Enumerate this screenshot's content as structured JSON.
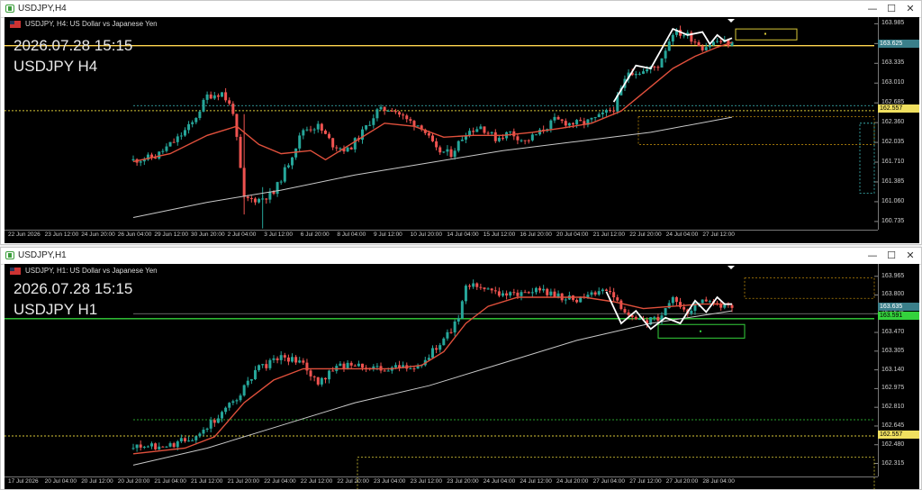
{
  "colors": {
    "bull": "#26a69a",
    "bear": "#ef5350",
    "ma_fast": "#e0503c",
    "ma_slow": "#c8c8c8",
    "hline": "#ffd54f",
    "gline": "#34d23c",
    "dots": "#d8c838",
    "zig": "#ffffff",
    "cyan": "#3fc0c0",
    "orange": "#b8860b"
  },
  "windows": [
    {
      "title": "USDJPY,H4",
      "description": "USDJPY, H4:  US Dollar vs Japanese Yen",
      "overlay_datetime": "2026.07.28 15:15",
      "overlay_symbol": "USDJPY H4",
      "price_labels": [
        "163.985",
        "163.660",
        "163.335",
        "163.010",
        "162.685",
        "162.360",
        "162.035",
        "161.710",
        "161.385",
        "161.060",
        "160.735"
      ],
      "current_price": "163.625",
      "dotted_price": "162.557",
      "time_labels": [
        "22 Jun 2026",
        "23 Jun 12:00",
        "24 Jun 20:00",
        "26 Jun 04:00",
        "29 Jun 12:00",
        "30 Jun 20:00",
        "2 Jul 04:00",
        "3 Jul 12:00",
        "6 Jul 20:00",
        "8 Jul 04:00",
        "9 Jul 12:00",
        "10 Jul 20:00",
        "14 Jul 04:00",
        "15 Jul 12:00",
        "16 Jul 20:00",
        "20 Jul 04:00",
        "21 Jul 12:00",
        "22 Jul 20:00",
        "24 Jul 04:00",
        "27 Jul 12:00"
      ],
      "buttons": {
        "minimize": "—",
        "maximize": "☐",
        "close": "✕"
      }
    },
    {
      "title": "USDJPY,H1",
      "description": "USDJPY, H1:  US Dollar vs Japanese Yen",
      "overlay_datetime": "2026.07.28 15:15",
      "overlay_symbol": "USDJPY H1",
      "price_labels": [
        "163.965",
        "163.800",
        "163.635",
        "163.470",
        "163.305",
        "163.140",
        "162.975",
        "162.810",
        "162.645",
        "162.480",
        "162.315"
      ],
      "current_price": "163.635",
      "green_price": "163.591",
      "dotted_price": "162.557",
      "time_labels": [
        "17 Jul 2026",
        "20 Jul 04:00",
        "20 Jul 12:00",
        "20 Jul 20:00",
        "21 Jul 04:00",
        "21 Jul 12:00",
        "21 Jul 20:00",
        "22 Jul 04:00",
        "22 Jul 12:00",
        "22 Jul 20:00",
        "23 Jul 04:00",
        "23 Jul 12:00",
        "23 Jul 20:00",
        "24 Jul 04:00",
        "24 Jul 12:00",
        "24 Jul 20:00",
        "27 Jul 04:00",
        "27 Jul 12:00",
        "27 Jul 20:00",
        "28 Jul 04:00"
      ],
      "buttons": {
        "minimize": "—",
        "maximize": "☐",
        "close": "✕"
      }
    }
  ],
  "chart_data": [
    {
      "type": "candlestick",
      "symbol": "USDJPY",
      "timeframe": "H4",
      "ylim": [
        160.6,
        164.05
      ],
      "close_path": [
        [
          0,
          161.74
        ],
        [
          6,
          161.8
        ],
        [
          12,
          162.1
        ],
        [
          16,
          162.35
        ],
        [
          20,
          162.8
        ],
        [
          24,
          162.85
        ],
        [
          27,
          162.55
        ],
        [
          30,
          161.1
        ],
        [
          34,
          161.1
        ],
        [
          38,
          161.2
        ],
        [
          42,
          161.7
        ],
        [
          46,
          162.25
        ],
        [
          50,
          162.3
        ],
        [
          54,
          162.0
        ],
        [
          58,
          161.9
        ],
        [
          62,
          162.2
        ],
        [
          66,
          162.55
        ],
        [
          70,
          162.6
        ],
        [
          74,
          162.4
        ],
        [
          78,
          162.3
        ],
        [
          82,
          161.9
        ],
        [
          86,
          161.85
        ],
        [
          90,
          162.2
        ],
        [
          94,
          162.3
        ],
        [
          98,
          162.1
        ],
        [
          102,
          162.2
        ],
        [
          106,
          162.05
        ],
        [
          110,
          162.2
        ],
        [
          114,
          162.4
        ],
        [
          118,
          162.35
        ],
        [
          122,
          162.35
        ],
        [
          126,
          162.45
        ],
        [
          130,
          162.6
        ],
        [
          134,
          163.2
        ],
        [
          138,
          163.2
        ],
        [
          142,
          163.3
        ],
        [
          146,
          163.85
        ],
        [
          150,
          163.8
        ],
        [
          154,
          163.6
        ],
        [
          158,
          163.7
        ],
        [
          162,
          163.65
        ]
      ],
      "ma_fast_path": [
        [
          0,
          161.72
        ],
        [
          10,
          161.85
        ],
        [
          20,
          162.15
        ],
        [
          28,
          162.3
        ],
        [
          34,
          162.0
        ],
        [
          40,
          161.85
        ],
        [
          48,
          161.9
        ],
        [
          52,
          161.75
        ],
        [
          60,
          162.05
        ],
        [
          68,
          162.35
        ],
        [
          76,
          162.3
        ],
        [
          84,
          162.12
        ],
        [
          92,
          162.15
        ],
        [
          100,
          162.15
        ],
        [
          108,
          162.2
        ],
        [
          116,
          162.27
        ],
        [
          124,
          162.35
        ],
        [
          132,
          162.55
        ],
        [
          140,
          162.95
        ],
        [
          146,
          163.25
        ],
        [
          152,
          163.45
        ],
        [
          158,
          163.6
        ],
        [
          162,
          163.68
        ]
      ],
      "ma_slow_path": [
        [
          0,
          160.8
        ],
        [
          20,
          161.05
        ],
        [
          40,
          161.25
        ],
        [
          60,
          161.5
        ],
        [
          80,
          161.7
        ],
        [
          100,
          161.9
        ],
        [
          120,
          162.05
        ],
        [
          140,
          162.2
        ],
        [
          162,
          162.45
        ]
      ],
      "zigzag_path": [
        [
          130,
          162.7
        ],
        [
          134,
          163.1
        ],
        [
          136,
          163.3
        ],
        [
          140,
          163.25
        ],
        [
          146,
          163.9
        ],
        [
          150,
          163.8
        ],
        [
          154,
          163.85
        ],
        [
          156,
          163.65
        ],
        [
          158,
          163.8
        ],
        [
          160,
          163.7
        ],
        [
          162,
          163.75
        ]
      ]
    },
    {
      "type": "candlestick",
      "symbol": "USDJPY",
      "timeframe": "H1",
      "ylim": [
        162.2,
        164.05
      ],
      "close_path": [
        [
          0,
          162.45
        ],
        [
          10,
          162.47
        ],
        [
          16,
          162.55
        ],
        [
          22,
          162.7
        ],
        [
          28,
          162.9
        ],
        [
          34,
          163.15
        ],
        [
          40,
          163.25
        ],
        [
          46,
          163.2
        ],
        [
          50,
          163.0
        ],
        [
          54,
          163.15
        ],
        [
          60,
          163.2
        ],
        [
          66,
          163.15
        ],
        [
          72,
          163.15
        ],
        [
          78,
          163.2
        ],
        [
          84,
          163.4
        ],
        [
          88,
          163.6
        ],
        [
          90,
          163.9
        ],
        [
          96,
          163.85
        ],
        [
          102,
          163.8
        ],
        [
          108,
          163.85
        ],
        [
          114,
          163.8
        ],
        [
          120,
          163.75
        ],
        [
          126,
          163.85
        ],
        [
          130,
          163.8
        ],
        [
          134,
          163.6
        ],
        [
          138,
          163.55
        ],
        [
          142,
          163.6
        ],
        [
          146,
          163.75
        ],
        [
          150,
          163.65
        ],
        [
          154,
          163.75
        ],
        [
          158,
          163.7
        ],
        [
          162,
          163.7
        ]
      ],
      "ma_fast_path": [
        [
          0,
          162.4
        ],
        [
          14,
          162.45
        ],
        [
          22,
          162.55
        ],
        [
          30,
          162.85
        ],
        [
          38,
          163.05
        ],
        [
          46,
          163.15
        ],
        [
          54,
          163.15
        ],
        [
          62,
          163.15
        ],
        [
          70,
          163.15
        ],
        [
          78,
          163.18
        ],
        [
          84,
          163.3
        ],
        [
          90,
          163.55
        ],
        [
          96,
          163.7
        ],
        [
          104,
          163.78
        ],
        [
          114,
          163.78
        ],
        [
          122,
          163.78
        ],
        [
          130,
          163.74
        ],
        [
          138,
          163.68
        ],
        [
          146,
          163.7
        ],
        [
          154,
          163.72
        ],
        [
          162,
          163.72
        ]
      ],
      "ma_slow_path": [
        [
          0,
          162.3
        ],
        [
          20,
          162.45
        ],
        [
          40,
          162.65
        ],
        [
          60,
          162.85
        ],
        [
          80,
          163.0
        ],
        [
          100,
          163.2
        ],
        [
          120,
          163.4
        ],
        [
          140,
          163.55
        ],
        [
          162,
          163.66
        ]
      ],
      "zigzag_path": [
        [
          128,
          163.83
        ],
        [
          132,
          163.55
        ],
        [
          136,
          163.66
        ],
        [
          140,
          163.5
        ],
        [
          144,
          163.6
        ],
        [
          148,
          163.55
        ],
        [
          152,
          163.75
        ],
        [
          155,
          163.65
        ],
        [
          158,
          163.78
        ],
        [
          160,
          163.72
        ],
        [
          162,
          163.72
        ]
      ]
    }
  ]
}
